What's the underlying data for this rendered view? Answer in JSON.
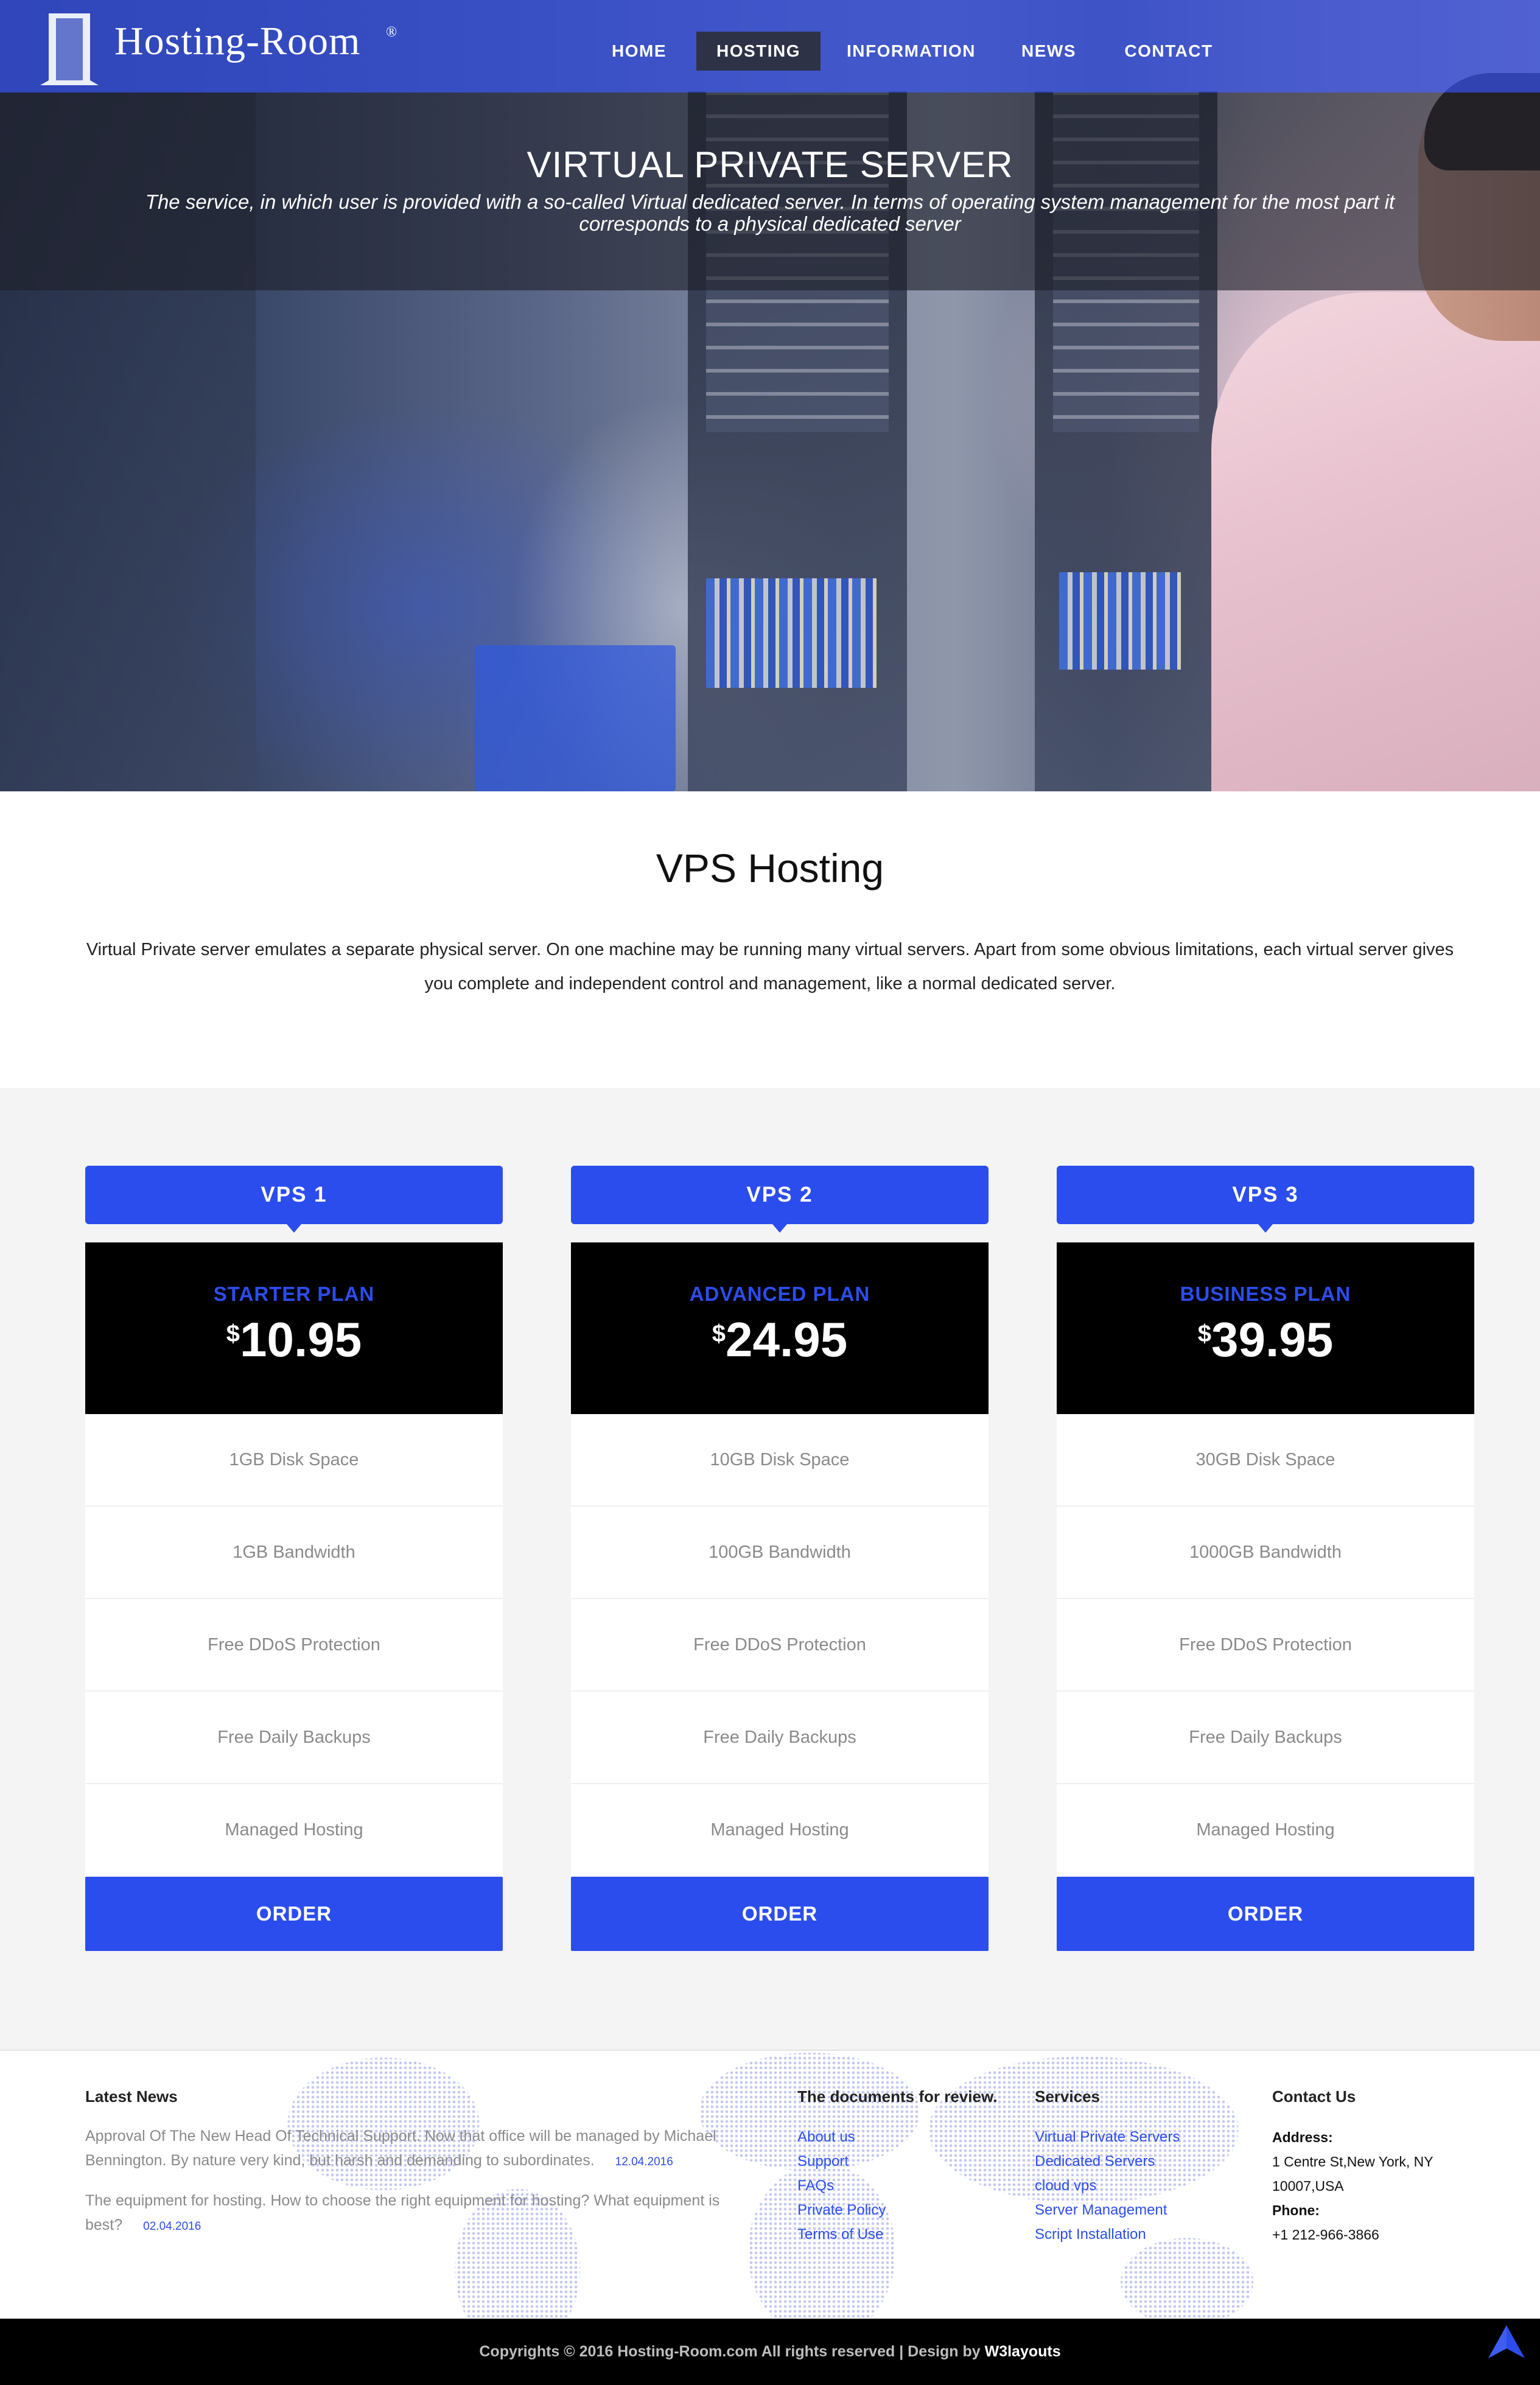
{
  "header": {
    "logo_text": "Hosting-Room",
    "logo_reg": "®",
    "nav": [
      {
        "label": "HOME",
        "active": false
      },
      {
        "label": "HOSTING",
        "active": true
      },
      {
        "label": "INFORMATION",
        "active": false
      },
      {
        "label": "NEWS",
        "active": false
      },
      {
        "label": "CONTACT",
        "active": false
      }
    ]
  },
  "hero": {
    "title": "VIRTUAL PRIVATE SERVER",
    "subtitle": "The service, in which user is provided with a so-called Virtual dedicated server. In terms of operating system management for the most part it corresponds to a physical dedicated server"
  },
  "intro": {
    "title": "VPS Hosting",
    "text": "Virtual Private server emulates a separate physical server. On one machine may be running many virtual servers. Apart from some obvious limitations, each virtual server gives you complete and independent control and management, like a normal dedicated server."
  },
  "plans": [
    {
      "tab": "VPS 1",
      "name": "STARTER PLAN",
      "currency": "$",
      "price": "10.95",
      "features": [
        "1GB Disk Space",
        "1GB Bandwidth",
        "Free DDoS Protection",
        "Free Daily Backups",
        "Managed Hosting"
      ],
      "order_label": "ORDER"
    },
    {
      "tab": "VPS 2",
      "name": "ADVANCED PLAN",
      "currency": "$",
      "price": "24.95",
      "features": [
        "10GB Disk Space",
        "100GB Bandwidth",
        "Free DDoS Protection",
        "Free Daily Backups",
        "Managed Hosting"
      ],
      "order_label": "ORDER"
    },
    {
      "tab": "VPS 3",
      "name": "BUSINESS PLAN",
      "currency": "$",
      "price": "39.95",
      "features": [
        "30GB Disk Space",
        "1000GB Bandwidth",
        "Free DDoS Protection",
        "Free Daily Backups",
        "Managed Hosting"
      ],
      "order_label": "ORDER"
    }
  ],
  "footer": {
    "latest_news": {
      "heading_a": "Latest ",
      "heading_b": "News",
      "items": [
        {
          "text": "Approval Of The New Head Of Technical Support. Now that office will be managed by Michael Bennington. By nature very kind, but harsh and demanding to subordinates.",
          "date": "12.04.2016"
        },
        {
          "text": "The equipment for hosting. How to choose the right equipment for hosting? What equipment is best?",
          "date": "02.04.2016"
        }
      ]
    },
    "documents": {
      "heading": "The documents for review.",
      "links": [
        "About us",
        "Support",
        "FAQs",
        "Private Policy",
        "Terms of Use"
      ]
    },
    "services": {
      "heading": "Services",
      "links": [
        "Virtual Private Servers",
        "Dedicated Servers",
        "cloud vps",
        "Server Management",
        "Script Installation"
      ]
    },
    "contact": {
      "heading": "Contact Us",
      "address_label": "Address:",
      "address": "1 Centre St,New York, NY 10007,USA",
      "phone_label": "Phone:",
      "phone": "+1 212-966-3866"
    },
    "copyright_text": "Copyrights © 2016 Hosting-Room.com All rights reserved | Design by ",
    "copyright_brand": "W3layouts"
  },
  "colors": {
    "accent": "#2c4ded",
    "nav_bg": "#324bd2",
    "dark": "#000000"
  },
  "icons": {
    "logo": "door-frame-icon",
    "to_top": "arrow-up-icon"
  }
}
